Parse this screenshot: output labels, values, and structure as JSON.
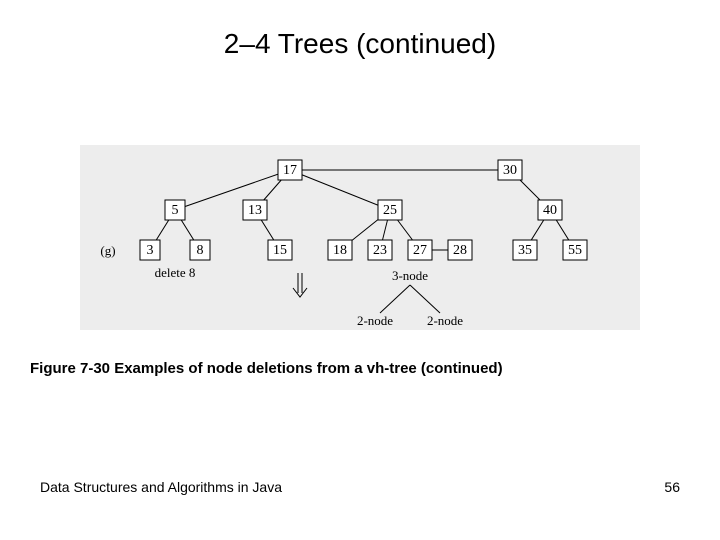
{
  "title": "2–4 Trees (continued)",
  "panel_label": "(g)",
  "action_label": "delete 8",
  "legend": {
    "top": "3-node",
    "left": "2-node",
    "right": "2-node"
  },
  "tree": {
    "n17": "17",
    "n30": "30",
    "n5": "5",
    "n13": "13",
    "n25": "25",
    "n40": "40",
    "n3": "3",
    "n8": "8",
    "n15": "15",
    "n18": "18",
    "n23": "23",
    "n27": "27",
    "n28": "28",
    "n35": "35",
    "n55": "55"
  },
  "caption": "Figure 7-30 Examples of node deletions from a vh-tree (continued)",
  "footer_left": "Data Structures and Algorithms in Java",
  "footer_right": "56"
}
